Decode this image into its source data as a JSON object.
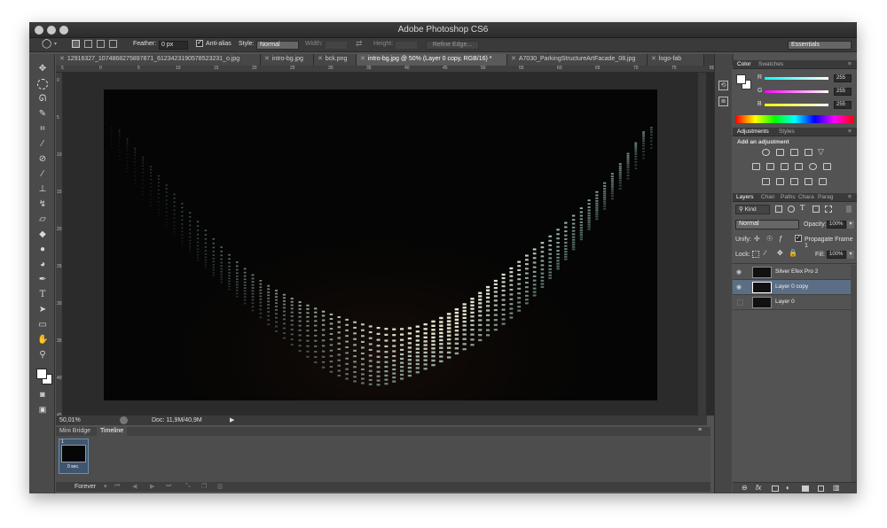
{
  "window": {
    "title": "Adobe Photoshop CS6"
  },
  "options_bar": {
    "feather_label": "Feather:",
    "feather_value": "0 px",
    "antialias_label": "Anti-alias",
    "style_label": "Style:",
    "style_value": "Normal",
    "width_label": "Width:",
    "height_label": "Height:",
    "refine_label": "Refine Edge...",
    "workspace_value": "Essentials"
  },
  "tabs": [
    {
      "label": "12916327_1074868275897871_6123423190578523231_o.jpg"
    },
    {
      "label": "intro-bg.jpg"
    },
    {
      "label": "bck.png"
    },
    {
      "label": "intro-bg.jpg @ 50% (Layer 0 copy, RGB/16) *"
    },
    {
      "label": "A7030_ParkingStructureArtFacade_08.jpg"
    },
    {
      "label": "logo-fab"
    }
  ],
  "ruler": {
    "top": [
      "5",
      "0",
      "5",
      "10",
      "15",
      "20",
      "25",
      "30",
      "35",
      "40",
      "45",
      "50",
      "55",
      "60",
      "65",
      "70",
      "75",
      "80"
    ],
    "left": [
      "0",
      "5",
      "10",
      "15",
      "20",
      "25",
      "30",
      "35",
      "40",
      "45"
    ]
  },
  "status": {
    "zoom": "50,01%",
    "doc": "Doc: 11,9M/40,9M"
  },
  "timeline": {
    "tabs": [
      "Mini Bridge",
      "Timeline"
    ],
    "frame_number": "1",
    "frame_delay": "0 sec.",
    "loop": "Forever"
  },
  "color_panel": {
    "tabs": [
      "Color",
      "Swatches"
    ],
    "channels": [
      {
        "label": "R",
        "value": "255"
      },
      {
        "label": "G",
        "value": "255"
      },
      {
        "label": "B",
        "value": "255"
      }
    ]
  },
  "adjustments_panel": {
    "tabs": [
      "Adjustments",
      "Styles"
    ],
    "heading": "Add an adjustment"
  },
  "layers_panel": {
    "tabs": [
      "Layers",
      "Chan",
      "Paths",
      "Chara",
      "Parag"
    ],
    "kind_label": "Kind",
    "blend_mode": "Normal",
    "opacity_label": "Opacity:",
    "opacity_value": "100%",
    "unify_label": "Unify:",
    "propagate_label": "Propagate Frame 1",
    "lock_label": "Lock:",
    "fill_label": "Fill:",
    "fill_value": "100%",
    "layers": [
      {
        "name": "Silver Efex Pro 2",
        "visible": true,
        "selected": false
      },
      {
        "name": "Layer 0 copy",
        "visible": true,
        "selected": true
      },
      {
        "name": "Layer 0",
        "visible": false,
        "selected": false
      }
    ]
  },
  "colors": {
    "accent_selected_layer": "#5c6e86",
    "ui_background": "#535353"
  }
}
